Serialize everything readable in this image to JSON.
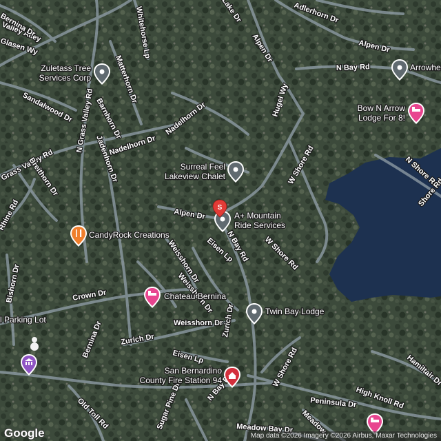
{
  "watermark": "Google",
  "attribution": "Map data ©2026 Imagery ©2026 Airbus, Maxar Technologies",
  "colors": {
    "lake": "#1d3150",
    "road": "#8c9aa3",
    "pin_gray": "#606a70",
    "pin_red": "#e23b36",
    "food": "#f07f2d",
    "lodging": "#e8458f",
    "museum": "#8f55c4",
    "fire": "#d32f3c"
  },
  "roads": [
    "Valley Alley",
    "Adlerhorn Dr",
    "Whitehorse Lp",
    "Alpen Dr",
    "Matterhorn Dr",
    "Alpen Dr",
    "N Bay Rd",
    "Hugel Wy",
    "Sandalwood Dr",
    "Barnhorn Dr",
    "N Grass Valley Rd",
    "Nadelhorn Dr",
    "Nadelhorn Dr",
    "Bernina Dr",
    "W Shore Rd",
    "N Shore Rd",
    "Grass Valley Rd",
    "Breithorn Dr",
    "Jadenhorn Dr",
    "Rhine Rd",
    "Alpen Dr",
    "N Bay Rd",
    "W Shore Rd",
    "Eisen Lp",
    "Weisshorn Dr",
    "Crown Dr",
    "Bishorn Dr",
    "Zurich Dr",
    "Weisshorn Dr",
    "Zurich Dr",
    "Bernina Dr",
    "Eisen Lp",
    "W Shore Rd",
    "Hamiltair Dr",
    "High Knoll Rd",
    "Peninsula Dr",
    "Old Toll Rd",
    "Sugar Pine Dr",
    "N Bay Rd",
    "Meadow Bay Dr",
    "Meadow",
    "Lake Dr",
    "Glasen Wy",
    "Weisshorn Dr",
    "Shore Rd"
  ],
  "places": [
    {
      "name_lines": [
        "Zuletass Tree",
        "Services Corp"
      ],
      "icon": "pin-gray"
    },
    {
      "name_lines": [
        "Arrowhead"
      ],
      "icon": "pin-gray"
    },
    {
      "name_lines": [
        "Bow N Arrow",
        "Lodge For 8!"
      ],
      "icon": "lodging"
    },
    {
      "name_lines": [
        "Surreal Feel",
        "Lakeview Chalet"
      ],
      "icon": "pin-gray"
    },
    {
      "name_lines": [
        "A+ Mountain",
        "Ride Services"
      ],
      "icon": "pin-gray",
      "selected_badge": "S"
    },
    {
      "name_lines": [
        "CandyRock Creations"
      ],
      "icon": "food"
    },
    {
      "name_lines": [
        "Chateau Bernina"
      ],
      "icon": "lodging"
    },
    {
      "name_lines": [
        "Twin Bay Lodge"
      ],
      "icon": "pin-gray"
    },
    {
      "name_lines": [
        "l Parking Lot"
      ],
      "icon": "none"
    },
    {
      "name_lines": [
        "San Bernardino",
        "County Fire Station 94"
      ],
      "icon": "fire"
    },
    {
      "name_lines": [
        ""
      ],
      "icon": "museum"
    },
    {
      "name_lines": [
        ""
      ],
      "icon": "lodging"
    }
  ]
}
